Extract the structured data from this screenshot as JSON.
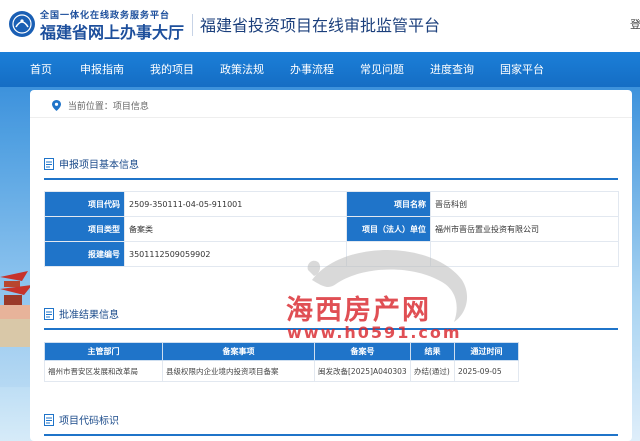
{
  "header": {
    "logo_line1": "全国一体化在线政务服务平台",
    "logo_line2": "福建省网上办事大厅",
    "site_title": "福建省投资项目在线审批监管平台",
    "right_text": "登"
  },
  "nav": {
    "items": [
      "首页",
      "申报指南",
      "我的项目",
      "政策法规",
      "办事流程",
      "常见问题",
      "进度查询",
      "国家平台"
    ]
  },
  "breadcrumb": {
    "prefix": "当前位置：",
    "current": "项目信息"
  },
  "basic_info": {
    "title": "申报项目基本信息",
    "rows": [
      {
        "k1": "项目代码",
        "v1": "2509-350111-04-05-911001",
        "k2": "项目名称",
        "v2": "晋岳科创"
      },
      {
        "k1": "项目类型",
        "v1": "备案类",
        "k2": "项目（法人）单位",
        "v2": "福州市晋岳置业投资有限公司"
      },
      {
        "k1": "报建编号",
        "v1": "3501112509059902",
        "k2": "",
        "v2": ""
      }
    ]
  },
  "approval": {
    "title": "批准结果信息",
    "headers": [
      "主管部门",
      "备案事项",
      "备案号",
      "结果",
      "通过时间"
    ],
    "rows": [
      [
        "福州市晋安区发展和改革局",
        "县级权限内企业境内投资项目备案",
        "闽发改备[2025]A040303",
        "办结(通过)",
        "2025-09-05"
      ]
    ]
  },
  "code_section": {
    "title": "项目代码标识"
  },
  "watermark": {
    "text": "海西房产网",
    "url": "www.h0591.com"
  },
  "colors": {
    "nav_blue": "#1b7fd8",
    "header_text": "#1d4f9c",
    "table_header": "#1f74c9",
    "watermark_red": "#d9242a"
  }
}
